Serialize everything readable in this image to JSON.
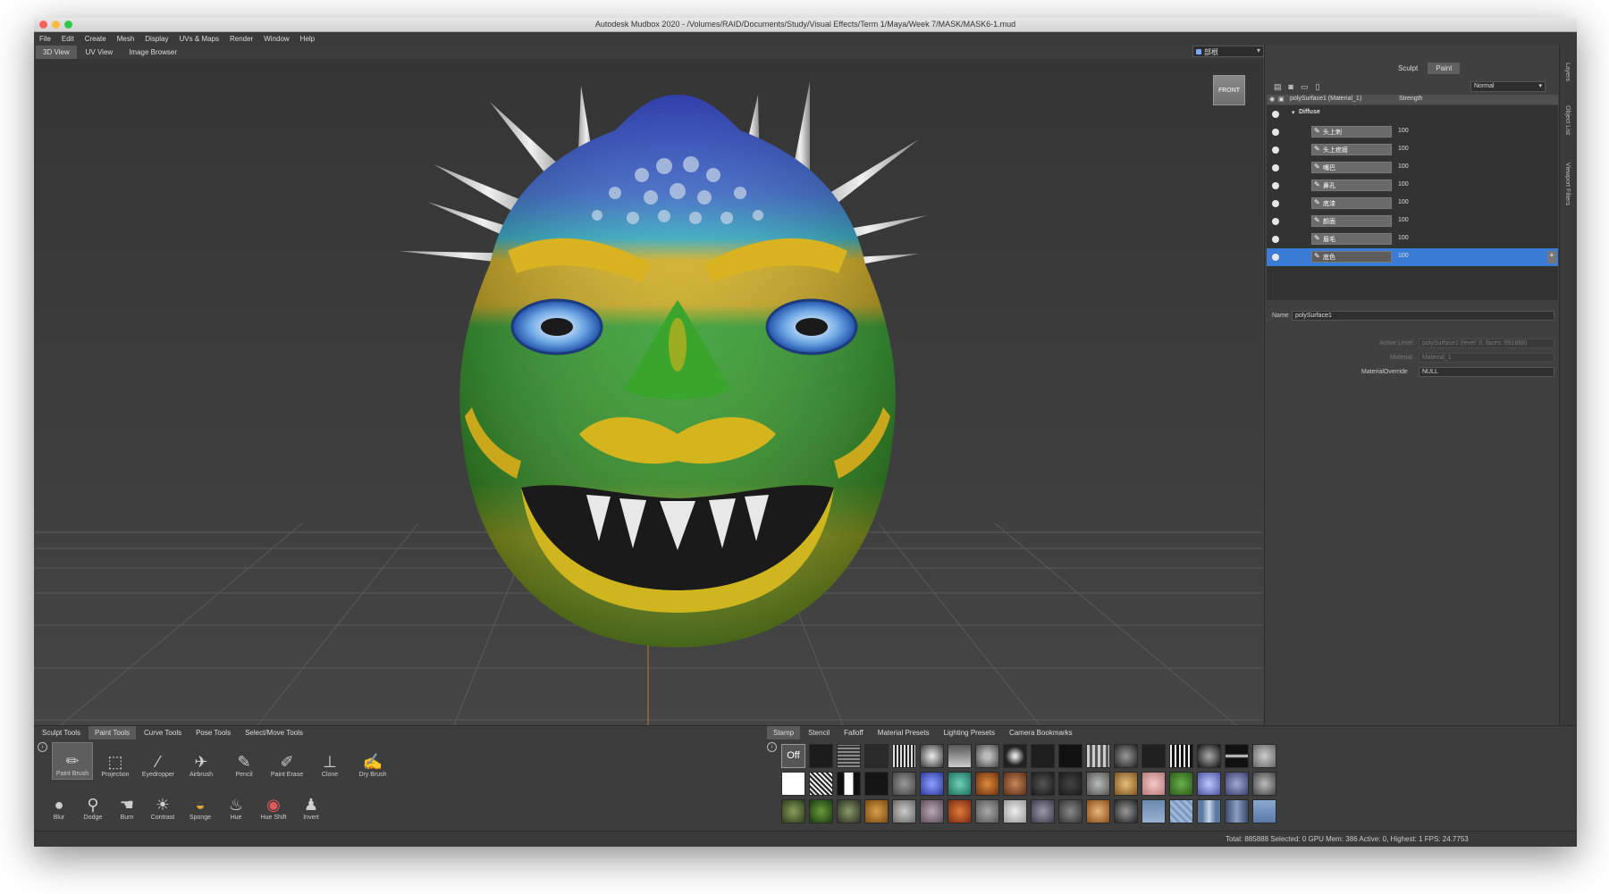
{
  "window": {
    "title": "Autodesk Mudbox 2020 - /Volumes/RAID/Documents/Study/Visual Effects/Term 1/Maya/Week 7/MASK/MASK6-1.mud"
  },
  "menu": [
    "File",
    "Edit",
    "Create",
    "Mesh",
    "Display",
    "UVs & Maps",
    "Render",
    "Window",
    "Help"
  ],
  "view_tabs": [
    "3D View",
    "UV View",
    "Image Browser"
  ],
  "camera_select": "部根",
  "viewcube_label": "FRONT",
  "right_panel": {
    "mode_tabs": [
      "Sculpt",
      "Paint"
    ],
    "blend_mode": "Normal",
    "layer_header": {
      "name": "polySurface1 (Material_1)",
      "col": "Strength"
    },
    "group": "Diffuse",
    "layers": [
      {
        "name": "头上刺",
        "value": "100"
      },
      {
        "name": "头上疙瘩",
        "value": "100"
      },
      {
        "name": "嘴巴",
        "value": "100"
      },
      {
        "name": "鼻孔",
        "value": "100"
      },
      {
        "name": "底漆",
        "value": "100"
      },
      {
        "name": "颜面",
        "value": "100"
      },
      {
        "name": "眉毛",
        "value": "100"
      },
      {
        "name": "底色",
        "value": "100"
      }
    ],
    "name_label": "Name",
    "name_value": "polySurface1",
    "active_level_label": "Active Level",
    "active_level_value": "polySurface1 (level: 0, faces: 891888)",
    "material_label": "Material",
    "material_value": "Material_1",
    "override_label": "MaterialOverride",
    "override_value": "NULL",
    "side_tabs": [
      "Layers",
      "Object List",
      "Viewport Filters"
    ]
  },
  "tool_tabs": [
    "Sculpt Tools",
    "Paint Tools",
    "Curve Tools",
    "Pose Tools",
    "Select/Move Tools"
  ],
  "tools_row1": [
    {
      "label": "Paint Brush",
      "icon": "✏"
    },
    {
      "label": "Projection",
      "icon": "⬚"
    },
    {
      "label": "Eyedropper",
      "icon": "⁄"
    },
    {
      "label": "Airbrush",
      "icon": "✈"
    },
    {
      "label": "Pencil",
      "icon": "✎"
    },
    {
      "label": "Paint Erase",
      "icon": "✐"
    },
    {
      "label": "Clone",
      "icon": "⊥"
    },
    {
      "label": "Dry Brush",
      "icon": "✍"
    }
  ],
  "tools_row2": [
    {
      "label": "Blur",
      "icon": "●"
    },
    {
      "label": "Dodge",
      "icon": "⚲"
    },
    {
      "label": "Burn",
      "icon": "☚"
    },
    {
      "label": "Contrast",
      "icon": "☀"
    },
    {
      "label": "Sponge",
      "icon": "◒"
    },
    {
      "label": "Hue",
      "icon": "♨"
    },
    {
      "label": "Hue Shift",
      "icon": "◉"
    },
    {
      "label": "Invert",
      "icon": "♟"
    }
  ],
  "stamp_tabs": [
    "Stamp",
    "Stencil",
    "Falloff",
    "Material Presets",
    "Lighting Presets",
    "Camera Bookmarks"
  ],
  "stamp_off_label": "Off",
  "status": "Total: 885888  Selected: 0 GPU Mem: 386  Active: 0, Highest: 1  FPS: 24.7753"
}
